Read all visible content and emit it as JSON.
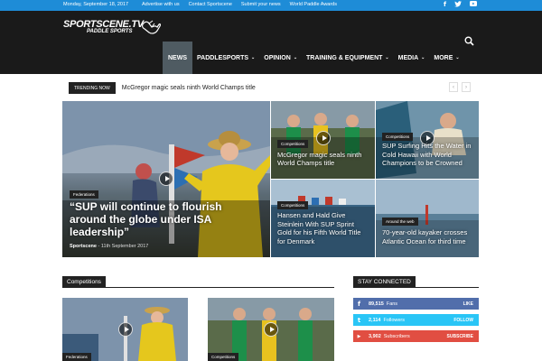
{
  "topbar": {
    "date": "Monday, September 18, 2017",
    "links": [
      "Advertise with us",
      "Contact Sportscene",
      "Submit your news",
      "World Paddle Awards"
    ],
    "social_icons": [
      "facebook-icon",
      "twitter-icon",
      "youtube-icon"
    ]
  },
  "header": {
    "logo_line1": "SPORTSCENE.TV",
    "logo_line2": "PADDLE SPORTS"
  },
  "nav": {
    "items": [
      {
        "label": "NEWS"
      },
      {
        "label": "PADDLESPORTS"
      },
      {
        "label": "OPINION"
      },
      {
        "label": "TRAINING & EQUIPMENT"
      },
      {
        "label": "MEDIA"
      },
      {
        "label": "MORE"
      }
    ],
    "caret": "⌄"
  },
  "trending": {
    "tag": "TRENDING NOW",
    "headline": "McGregor magic seals ninth World Champs title",
    "prev": "‹",
    "next": "›"
  },
  "featured": {
    "main": {
      "category": "Federations",
      "title": "“SUP will continue to flourish around the globe under ISA leadership”",
      "author": "Sportscene",
      "sep": " - ",
      "date": "11th September 2017"
    },
    "tiles": [
      {
        "category": "Competitions",
        "title": "McGregor magic seals ninth World Champs title"
      },
      {
        "category": "Competitions",
        "title": "SUP Surfing Hits the Water in Cold Hawaii with World Champions to be Crowned"
      },
      {
        "category": "Competitions",
        "title": "Hansen and Hald Give Steinlein With SUP Sprint Gold for his Fifth World Title for Denmark"
      },
      {
        "category": "Around the web",
        "title": "70-year-old kayaker crosses Atlantic Ocean for third time"
      }
    ]
  },
  "competitions": {
    "heading": "Competitions",
    "cards": [
      {
        "category": "Federations"
      },
      {
        "category": "Competitions"
      }
    ]
  },
  "stay_connected": {
    "heading": "STAY CONNECTED",
    "rows": [
      {
        "icon": "f",
        "count": "89,515",
        "label": "Fans",
        "action": "LIKE",
        "color": "#516eab"
      },
      {
        "icon": "t",
        "count": "2,114",
        "label": "Followers",
        "action": "FOLLOW",
        "color": "#29c5f6"
      },
      {
        "icon": "▶",
        "count": "3,902",
        "label": "Subscribers",
        "action": "SUBSCRIBE",
        "color": "#e14e42"
      }
    ]
  }
}
